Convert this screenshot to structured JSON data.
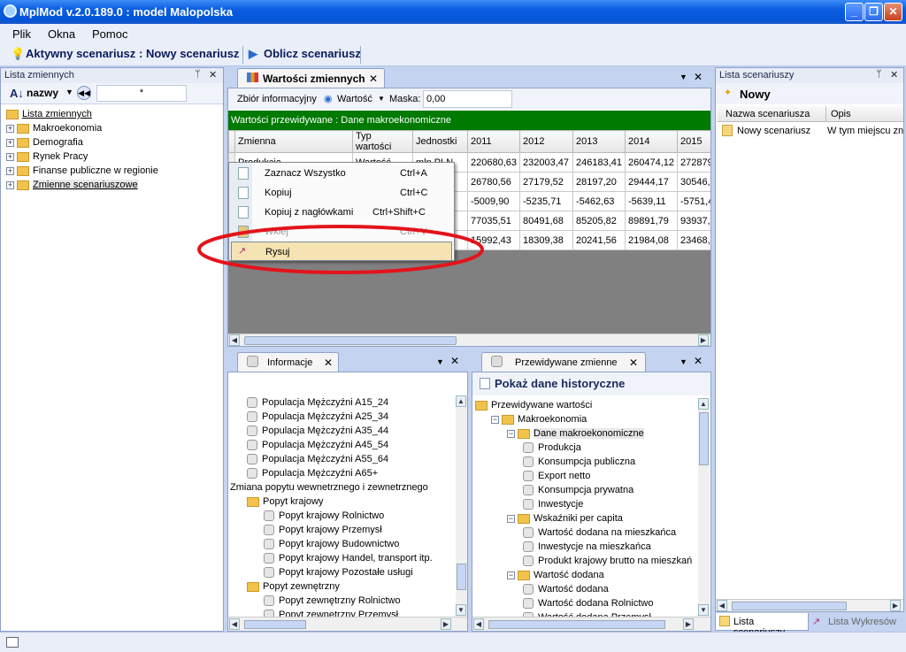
{
  "window": {
    "title": "MplMod v.2.0.189.0 : model Malopolska"
  },
  "menu": {
    "items": [
      "Plik",
      "Okna",
      "Pomoc"
    ]
  },
  "toolbar": {
    "active_label": "Aktywny scenariusz",
    "scenario_label": ": Nowy scenariusz",
    "compute_label": "Oblicz scenariusz"
  },
  "variables_panel": {
    "title": "Lista zmiennych",
    "sort_label": "nazwy",
    "filter_value": "*",
    "root": "Lista zmiennych",
    "items": [
      "Makroekonomia",
      "Demografia",
      "Rynek Pracy",
      "Finanse publiczne w regionie",
      "Zmienne scenariuszowe"
    ]
  },
  "values_tab": {
    "title": "Wartości zmiennych",
    "dataset_label": "Zbiór informacyjny",
    "value_label": "Wartość",
    "mask_label": "Maska:",
    "mask_value": "0,00",
    "banner": "Wartości przewidywane : Dane makroekonomiczne",
    "columns": [
      "Zmienna",
      "Typ wartości",
      "Jednostki",
      "2011",
      "2012",
      "2013",
      "2014",
      "2015"
    ],
    "rows": [
      {
        "name": "Produkcja",
        "type": "Wartość",
        "unit": "mln PLN",
        "vals": [
          "220680,63",
          "232003,47",
          "246183,41",
          "260474,12",
          "272879,"
        ]
      },
      {
        "name": "",
        "type": "",
        "unit": "",
        "vals": [
          "26780,56",
          "27179,52",
          "28197,20",
          "29444,17",
          "30546,6"
        ]
      },
      {
        "name": "",
        "type": "",
        "unit": "",
        "vals": [
          "-5009,90",
          "-5235,71",
          "-5462,63",
          "-5639,11",
          "-5751,4"
        ]
      },
      {
        "name": "",
        "type": "",
        "unit": "",
        "vals": [
          "77035,51",
          "80491,68",
          "85205,82",
          "89891,79",
          "93937,"
        ]
      },
      {
        "name": "",
        "type": "",
        "unit": "",
        "vals": [
          "15992,43",
          "18309,38",
          "20241,56",
          "21984,08",
          "23468,2"
        ]
      }
    ]
  },
  "context_menu": {
    "items": [
      {
        "label": "Zaznacz Wszystko",
        "shortcut": "Ctrl+A"
      },
      {
        "label": "Kopiuj",
        "shortcut": "Ctrl+C"
      },
      {
        "label": "Kopiuj z nagłówkami",
        "shortcut": "Ctrl+Shift+C"
      },
      {
        "label": "Wklej",
        "shortcut": "Ctrl+V"
      },
      {
        "label": "Rysuj",
        "shortcut": ""
      }
    ]
  },
  "info_tab": {
    "title": "Informacje",
    "items": [
      {
        "label": "Populacja Mężczyźni A15_24",
        "level": 1,
        "icon": "cube"
      },
      {
        "label": "Populacja Mężczyźni A25_34",
        "level": 1,
        "icon": "cube"
      },
      {
        "label": "Populacja Mężczyźni A35_44",
        "level": 1,
        "icon": "cube"
      },
      {
        "label": "Populacja Mężczyźni A45_54",
        "level": 1,
        "icon": "cube"
      },
      {
        "label": "Populacja Mężczyźni A55_64",
        "level": 1,
        "icon": "cube"
      },
      {
        "label": "Populacja Mężczyźni A65+",
        "level": 1,
        "icon": "cube"
      },
      {
        "label": "Zmiana popytu wewnetrznego i zewnetrznego",
        "level": 0,
        "icon": "none"
      },
      {
        "label": "Popyt krajowy",
        "level": 1,
        "icon": "folder"
      },
      {
        "label": "Popyt krajowy Rolnictwo",
        "level": 2,
        "icon": "cube"
      },
      {
        "label": "Popyt krajowy Przemysł",
        "level": 2,
        "icon": "cube"
      },
      {
        "label": "Popyt krajowy Budownictwo",
        "level": 2,
        "icon": "cube"
      },
      {
        "label": "Popyt krajowy Handel, transport itp.",
        "level": 2,
        "icon": "cube"
      },
      {
        "label": "Popyt krajowy Pozostałe usługi",
        "level": 2,
        "icon": "cube"
      },
      {
        "label": "Popyt zewnętrzny",
        "level": 1,
        "icon": "folder"
      },
      {
        "label": "Popyt zewnętrzny Rolnictwo",
        "level": 2,
        "icon": "cube"
      },
      {
        "label": "Popyt zewnętrzny Przemysł",
        "level": 2,
        "icon": "cube"
      }
    ]
  },
  "forecast_tab": {
    "title": "Przewidywane zmienne",
    "show_history": "Pokaż dane historyczne",
    "items": [
      {
        "label": "Przewidywane wartości",
        "level": 0,
        "icon": "folder"
      },
      {
        "label": "Makroekonomia",
        "level": 1,
        "icon": "folder"
      },
      {
        "label": "Dane makroekonomiczne",
        "level": 2,
        "icon": "folder"
      },
      {
        "label": "Produkcja",
        "level": 3,
        "icon": "cube"
      },
      {
        "label": "Konsumpcja publiczna",
        "level": 3,
        "icon": "cube"
      },
      {
        "label": "Export netto",
        "level": 3,
        "icon": "cube"
      },
      {
        "label": "Konsumpcja prywatna",
        "level": 3,
        "icon": "cube"
      },
      {
        "label": "Inwestycje",
        "level": 3,
        "icon": "cube"
      },
      {
        "label": "Wskaźniki per capita",
        "level": 2,
        "icon": "folder"
      },
      {
        "label": "Wartość dodana na mieszkańca",
        "level": 3,
        "icon": "cube"
      },
      {
        "label": "Inwestycje na mieszkańca",
        "level": 3,
        "icon": "cube"
      },
      {
        "label": "Produkt krajowy brutto na mieszkań",
        "level": 3,
        "icon": "cube"
      },
      {
        "label": "Wartość dodana",
        "level": 2,
        "icon": "folder"
      },
      {
        "label": "Wartość dodana",
        "level": 3,
        "icon": "cube"
      },
      {
        "label": "Wartość dodana Rolnictwo",
        "level": 3,
        "icon": "cube"
      },
      {
        "label": "Wartość dodana Przemysł",
        "level": 3,
        "icon": "cube"
      }
    ]
  },
  "scenarios_panel": {
    "title": "Lista scenariuszy",
    "new_label": "Nowy",
    "col_name": "Nazwa scenariusza",
    "col_desc": "Opis",
    "row_name": "Nowy scenariusz",
    "row_desc": "W tym miejscu zna",
    "tab_scen": "Lista scenariuszy",
    "tab_charts": "Lista Wykresów"
  },
  "colors": {
    "banner": "#007a00",
    "highlight": "#f5e3b3",
    "annotation": "#e3141b"
  }
}
